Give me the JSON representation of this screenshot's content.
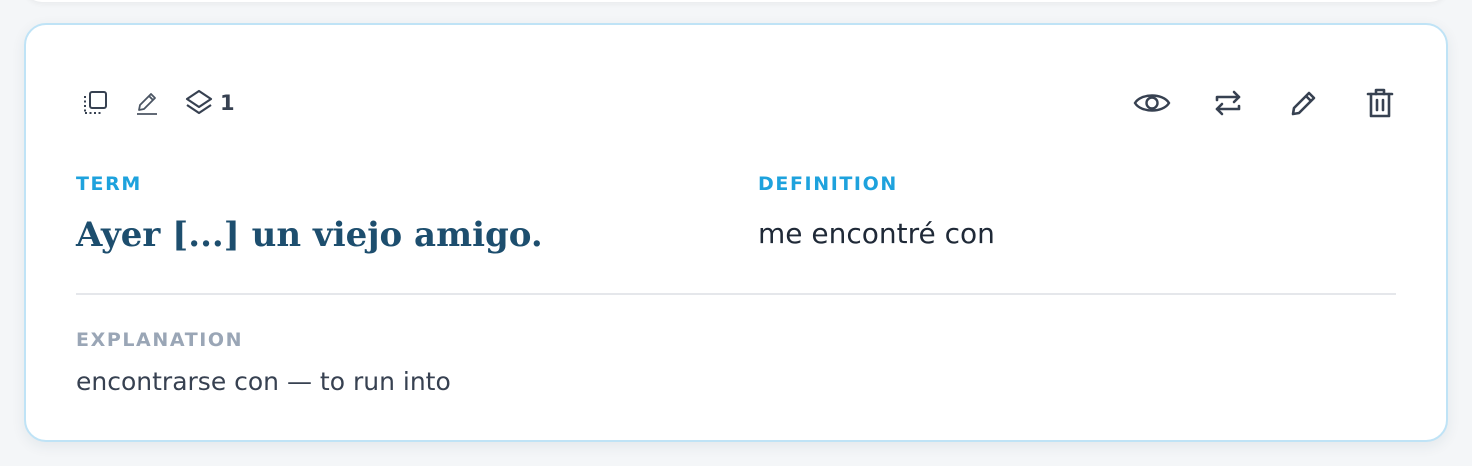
{
  "card": {
    "layer_count": "1",
    "term_label": "TERM",
    "term": "Ayer [...] un viejo amigo.",
    "definition_label": "DEFINITION",
    "definition": "me encontré con",
    "explanation_label": "EXPLANATION",
    "explanation": "encontrarse con — to run into"
  },
  "icons": {
    "left": [
      "select-card-icon",
      "edit-note-icon",
      "layers-icon"
    ],
    "right": [
      "eye-icon",
      "repeat-icon",
      "pencil-icon",
      "trash-icon"
    ]
  },
  "colors": {
    "accent": "#1ea2dd",
    "term_text": "#1d4e6e",
    "card_border": "#bfe3f6",
    "muted_label": "#9aa6b6"
  }
}
